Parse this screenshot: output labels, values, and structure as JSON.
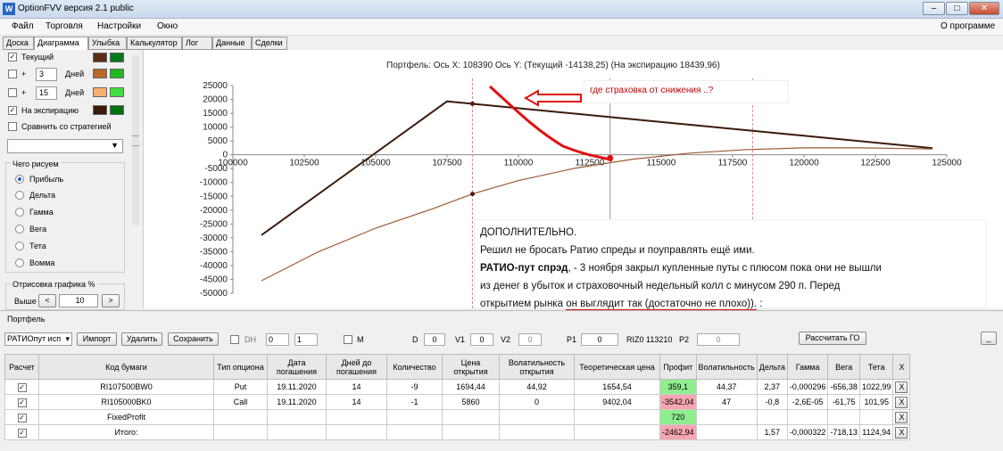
{
  "window": {
    "title": "OptionFVV версия 2.1 public",
    "min": "–",
    "max": "□",
    "close": "✕"
  },
  "menu": {
    "items": [
      "Файл",
      "Торговля",
      "Настройки",
      "Окно"
    ],
    "about": "О программе"
  },
  "tabs": [
    "Доска",
    "Диаграмма",
    "Улыбка",
    "Калькулятор",
    "Лог",
    "Данные",
    "Сделки"
  ],
  "left": {
    "current": "Текущий",
    "plus1": "+",
    "days1": "3",
    "days_label1": "Дней",
    "plus2": "+",
    "days2": "15",
    "days_label2": "Дней",
    "expiration": "На экспирацию",
    "compare": "Сравнить со стратегией",
    "group_title": "Чего рисуем",
    "options": [
      "Прибыль",
      "Дельта",
      "Гамма",
      "Вега",
      "Тета",
      "Вомма"
    ],
    "draw_title": "Отрисовка графика %",
    "above": "Выше",
    "above_val": "10",
    "left_arrow": "<",
    "right_arrow": ">",
    "colors": {
      "current_a": "#5a2e14",
      "current_b": "#007a1e",
      "d3_a": "#b8682a",
      "d3_b": "#1fb81f",
      "d15_a": "#f5b070",
      "d15_b": "#40e040",
      "exp_a": "#3a1a08",
      "exp_b": "#007010"
    }
  },
  "chart_header": "Портфель: Ось X: 108390 Ось Y:  (Текущий -14138,25)  (На экспирацию 18439,96)",
  "annotation1": "где страховка от снижения ..?",
  "annotation2": {
    "line1": "ДОПОЛНИТЕЛЬНО.",
    "line2": "Решил не бросать Ратио спреды и поуправлять ещё ими.",
    "line3_bold": "РАТИО-пут спрэд",
    "line3_rest": ", - 3 ноября закрыл купленные путы с плюсом пока они не вышли",
    "line4": "из денег в убыток и страховочный недельный колл с минусом 290 п. Перед",
    "line5_a": "открытием рынка ",
    "line5_b": "он выглядит так (достаточно не плохо)).",
    "line5_c": "  :"
  },
  "chart_data": {
    "type": "line",
    "x_ticks": [
      "100000",
      "102500",
      "105000",
      "107500",
      "110000",
      "112500",
      "115000",
      "117500",
      "120000",
      "122500",
      "125000"
    ],
    "y_ticks": [
      "25000",
      "20000",
      "15000",
      "10000",
      "5000",
      "0",
      "-5000",
      "-10000",
      "-15000",
      "-20000",
      "-25000",
      "-30000",
      "-35000",
      "-40000",
      "-45000",
      "-50000"
    ],
    "xlim": [
      100000,
      125000
    ],
    "ylim": [
      -50000,
      25000
    ],
    "series": [
      {
        "name": "На экспирацию",
        "color": "#3a1a08",
        "x": [
          101000,
          107500,
          124500
        ],
        "y": [
          -29000,
          19300,
          2400
        ]
      },
      {
        "name": "Текущий",
        "color": "#9c5a34",
        "x": [
          101000,
          103000,
          105000,
          107000,
          108390,
          110000,
          112000,
          114000,
          116000,
          118000,
          120000,
          122000,
          124500
        ],
        "y": [
          -45500,
          -35000,
          -26500,
          -19500,
          -14138,
          -9300,
          -4800,
          -1600,
          600,
          1900,
          2500,
          2500,
          2100
        ]
      }
    ],
    "markers": [
      {
        "x": 108390,
        "y": 18439,
        "color": "#5a1a10"
      },
      {
        "x": 108390,
        "y": -14138,
        "color": "#5a1a10"
      },
      {
        "x": 113210,
        "y": -1200,
        "color": "#e01010"
      }
    ],
    "vlines": [
      {
        "x": 108390,
        "color": "#f08080"
      },
      {
        "x": 113210,
        "color": "#999999"
      },
      {
        "x": 118200,
        "color": "#f08080"
      }
    ]
  },
  "portfolio": {
    "label": "Портфель",
    "combo": "РАТИОпут исп",
    "import": "Импорт",
    "delete": "Удалить",
    "save": "Сохранить",
    "dh_label": "DH",
    "dh_a": "0",
    "dh_b": "1",
    "m_label": "M",
    "d_label": "D",
    "d_val": "0",
    "v1_label": "V1",
    "v1_val": "0",
    "v2_label": "V2",
    "v2_val": "0",
    "p1_label": "P1",
    "p1_val": "0",
    "riz_label": "RIZ0 113210",
    "p2_label": "P2",
    "p2_val": "0",
    "calc_go": "Рассчитать ГО",
    "minimize": "_"
  },
  "table": {
    "headers": [
      "Расчет",
      "Код бумаги",
      "Тип опциона",
      "Дата погашения",
      "Дней до погашения",
      "Количество",
      "Цена открытия",
      "Волатильность открытия",
      "Теоретическая цена",
      "Профит",
      "Волатильность",
      "Дельта",
      "Гамма",
      "Вега",
      "Тета",
      "X"
    ],
    "rows": [
      {
        "check": "✓",
        "code": "RI107500BW0",
        "type": "Put",
        "date": "19.11.2020",
        "days": "14",
        "qty": "-9",
        "price": "1694,44",
        "vol_open": "44,92",
        "theo": "1654,54",
        "profit": "359,1",
        "profit_class": "green",
        "vol": "44,37",
        "delta": "2,37",
        "gamma": "-0,000296",
        "vega": "-656,38",
        "theta": "1022,99",
        "x": "X"
      },
      {
        "check": "✓",
        "code": "RI105000BK0",
        "type": "Call",
        "date": "19.11.2020",
        "days": "14",
        "qty": "-1",
        "price": "5860",
        "vol_open": "0",
        "theo": "9402,04",
        "profit": "-3542,04",
        "profit_class": "red",
        "vol": "47",
        "delta": "-0,8",
        "gamma": "-2,6E-05",
        "vega": "-61,75",
        "theta": "101,95",
        "x": "X"
      },
      {
        "check": "✓",
        "code": "FixedProfit",
        "type": "",
        "date": "",
        "days": "",
        "qty": "",
        "price": "",
        "vol_open": "",
        "theo": "",
        "profit": "720",
        "profit_class": "green",
        "vol": "",
        "delta": "",
        "gamma": "",
        "vega": "",
        "theta": "",
        "x": "X"
      },
      {
        "check": "✓",
        "code": "Итого:",
        "type": "",
        "date": "",
        "days": "",
        "qty": "",
        "price": "",
        "vol_open": "",
        "theo": "",
        "profit": "-2462,94",
        "profit_class": "red",
        "vol": "",
        "delta": "1,57",
        "gamma": "-0,000322",
        "vega": "-718,13",
        "theta": "1124,94",
        "x": "X"
      }
    ]
  }
}
